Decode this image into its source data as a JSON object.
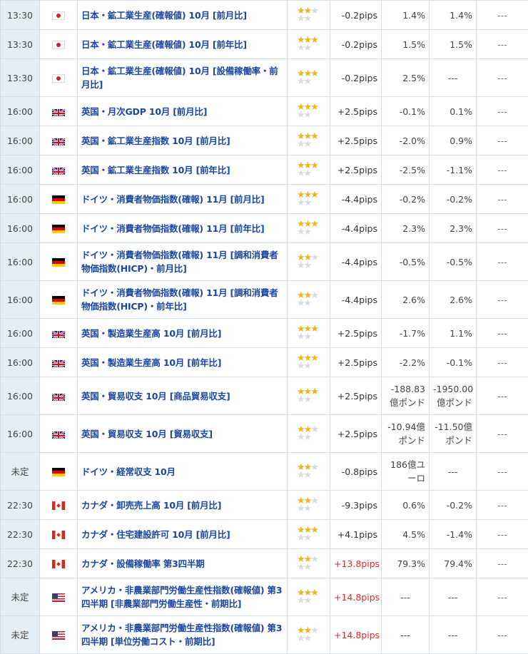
{
  "colors": {
    "link": "#1a47a2",
    "time_bg": "#e3eef6",
    "star_on": "#f2b317",
    "star_off": "#d7dbe1",
    "pips_up": "#e8272b"
  },
  "events": [
    {
      "time": "13:30",
      "flag": "jp-flag-icon",
      "name": "日本・鉱工業生産(確報値) 10月 [前月比]",
      "stars": 2,
      "pips": "-0.2pips",
      "actual": "1.4%",
      "forecast": "1.4%",
      "previous": "---",
      "h": 41
    },
    {
      "time": "13:30",
      "flag": "jp-flag-icon",
      "name": "日本・鉱工業生産(確報値) 10月 [前年比]",
      "stars": 3,
      "pips": "-0.2pips",
      "actual": "1.5%",
      "forecast": "1.5%",
      "previous": "---",
      "h": 41
    },
    {
      "time": "13:30",
      "flag": "jp-flag-icon",
      "name": "日本・鉱工業生産(確報値) 10月 [設備稼働率・前月比]",
      "stars": 3,
      "pips": "-0.2pips",
      "actual": "2.5%",
      "forecast": "---",
      "previous": "---",
      "h": 53
    },
    {
      "time": "16:00",
      "flag": "uk-flag-icon",
      "name": "英国・月次GDP 10月 [前月比]",
      "stars": 3,
      "pips": "+2.5pips",
      "actual": "-0.1%",
      "forecast": "0.1%",
      "previous": "---",
      "h": 41
    },
    {
      "time": "16:00",
      "flag": "uk-flag-icon",
      "name": "英国・鉱工業生産指数 10月 [前月比]",
      "stars": 3,
      "pips": "+2.5pips",
      "actual": "-2.0%",
      "forecast": "0.9%",
      "previous": "---",
      "h": 41
    },
    {
      "time": "16:00",
      "flag": "uk-flag-icon",
      "name": "英国・鉱工業生産指数 10月 [前年比]",
      "stars": 3,
      "pips": "+2.5pips",
      "actual": "-2.5%",
      "forecast": "-1.1%",
      "previous": "---",
      "h": 41
    },
    {
      "time": "16:00",
      "flag": "de-flag-icon",
      "name": "ドイツ・消費者物価指数(確報) 11月 [前月比]",
      "stars": 3,
      "pips": "-4.4pips",
      "actual": "-0.2%",
      "forecast": "-0.2%",
      "previous": "---",
      "h": 41
    },
    {
      "time": "16:00",
      "flag": "de-flag-icon",
      "name": "ドイツ・消費者物価指数(確報) 11月 [前年比]",
      "stars": 3,
      "pips": "-4.4pips",
      "actual": "2.3%",
      "forecast": "2.3%",
      "previous": "---",
      "h": 41
    },
    {
      "time": "16:00",
      "flag": "de-flag-icon",
      "name": "ドイツ・消費者物価指数(確報) 11月 [調和消費者物価指数(HICP)・前月比]",
      "stars": 2,
      "pips": "-4.4pips",
      "actual": "-0.5%",
      "forecast": "-0.5%",
      "previous": "---",
      "h": 53
    },
    {
      "time": "16:00",
      "flag": "de-flag-icon",
      "name": "ドイツ・消費者物価指数(確報) 11月 [調和消費者物価指数(HICP)・前年比]",
      "stars": 2,
      "pips": "-4.4pips",
      "actual": "2.6%",
      "forecast": "2.6%",
      "previous": "---",
      "h": 53
    },
    {
      "time": "16:00",
      "flag": "uk-flag-icon",
      "name": "英国・製造業生産高 10月 [前月比]",
      "stars": 3,
      "pips": "+2.5pips",
      "actual": "-1.7%",
      "forecast": "1.1%",
      "previous": "---",
      "h": 41
    },
    {
      "time": "16:00",
      "flag": "uk-flag-icon",
      "name": "英国・製造業生産高 10月 [前年比]",
      "stars": 3,
      "pips": "+2.5pips",
      "actual": "-2.2%",
      "forecast": "-0.1%",
      "previous": "---",
      "h": 41
    },
    {
      "time": "16:00",
      "flag": "uk-flag-icon",
      "name": "英国・貿易収支 10月 [商品貿易収支]",
      "stars": 3,
      "pips": "+2.5pips",
      "actual": "-188.83億ポンド",
      "forecast": "-1950.00億ポンド",
      "previous": "---",
      "h": 53
    },
    {
      "time": "16:00",
      "flag": "uk-flag-icon",
      "name": "英国・貿易収支 10月 [貿易収支]",
      "stars": 2,
      "pips": "+2.5pips",
      "actual": "-10.94億ポンド",
      "forecast": "-11.50億ポンド",
      "previous": "---",
      "h": 53
    },
    {
      "time": "未定",
      "flag": "de-flag-icon",
      "name": "ドイツ・経常収支 10月",
      "stars": 2,
      "pips": "-0.8pips",
      "actual": "186億ユーロ",
      "forecast": "---",
      "previous": "---",
      "h": 53
    },
    {
      "time": "22:30",
      "flag": "ca-flag-icon",
      "name": "カナダ・卸売売上高 10月 [前月比]",
      "stars": 2,
      "pips": "-9.3pips",
      "actual": "0.6%",
      "forecast": "-0.2%",
      "previous": "---",
      "h": 41
    },
    {
      "time": "22:30",
      "flag": "ca-flag-icon",
      "name": "カナダ・住宅建設許可 10月 [前月比]",
      "stars": 3,
      "pips": "+4.1pips",
      "actual": "4.5%",
      "forecast": "-1.4%",
      "previous": "---",
      "h": 41
    },
    {
      "time": "22:30",
      "flag": "ca-flag-icon",
      "name": "カナダ・設備稼働率 第3四半期",
      "stars": 2,
      "pips": "+13.8pips",
      "actual": "79.3%",
      "forecast": "79.4%",
      "previous": "---",
      "h": 41
    },
    {
      "time": "未定",
      "flag": "us-flag-icon",
      "name": "アメリカ・非農業部門労働生産性指数(確報値) 第3四半期 [非農業部門労働生産性・前期比]",
      "stars": 3,
      "pips": "+14.8pips",
      "actual": "---",
      "forecast": "---",
      "previous": "---",
      "h": 53
    },
    {
      "time": "未定",
      "flag": "us-flag-icon",
      "name": "アメリカ・非農業部門労働生産性指数(確報値) 第3四半期 [単位労働コスト・前期比]",
      "stars": 2,
      "pips": "+14.8pips",
      "actual": "---",
      "forecast": "---",
      "previous": "---",
      "h": 53
    }
  ]
}
